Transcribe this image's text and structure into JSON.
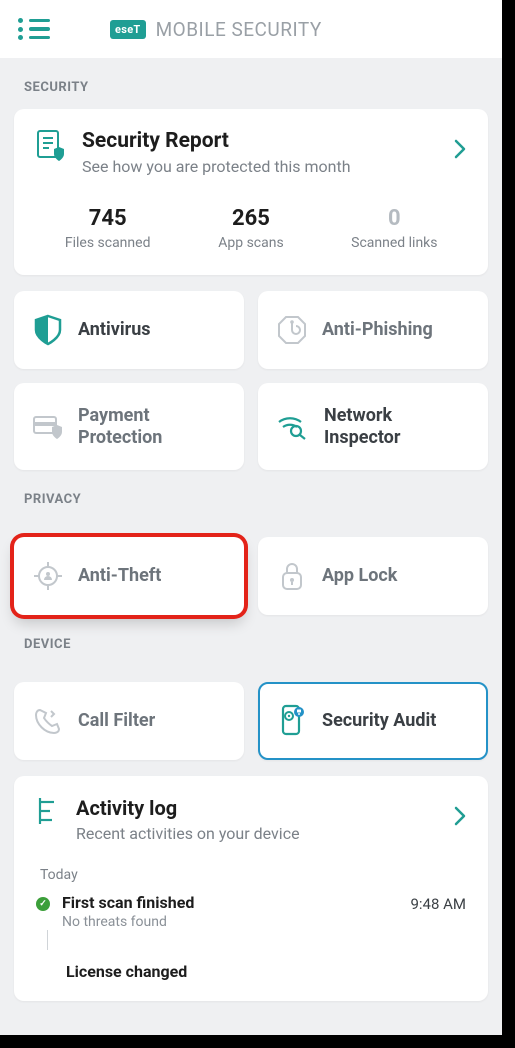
{
  "brand": {
    "logo_text": "eseT",
    "title": "MOBILE SECURITY"
  },
  "sections": {
    "security": "SECURITY",
    "privacy": "PRIVACY",
    "device": "DEVICE"
  },
  "report": {
    "title": "Security Report",
    "subtitle": "See how you are protected this month",
    "stats": [
      {
        "value": "745",
        "label": "Files scanned"
      },
      {
        "value": "265",
        "label": "App scans"
      },
      {
        "value": "0",
        "label": "Scanned links"
      }
    ]
  },
  "tiles": {
    "antivirus": "Antivirus",
    "antiphishing": "Anti-Phishing",
    "payment": "Payment Protection",
    "network": "Network Inspector",
    "antitheft": "Anti-Theft",
    "applock": "App Lock",
    "callfilter": "Call Filter",
    "audit": "Security Audit"
  },
  "activity": {
    "title": "Activity log",
    "subtitle": "Recent activities on your device",
    "today_label": "Today",
    "items": [
      {
        "title": "First scan finished",
        "subtitle": "No threats found",
        "time": "9:48 AM"
      }
    ],
    "cutoff_title": "License changed"
  },
  "colors": {
    "accent": "#1f9e94",
    "blue": "#2492c7",
    "highlight": "#e32319"
  }
}
